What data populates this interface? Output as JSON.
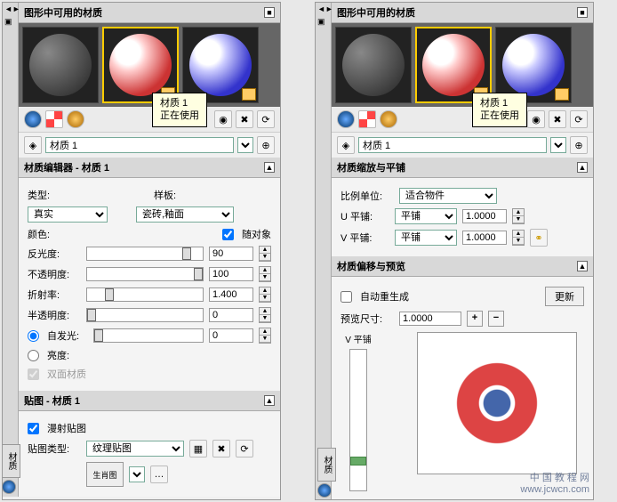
{
  "left": {
    "vtabs": [
      "材质"
    ],
    "header": "图形中可用的材质",
    "tooltip": {
      "line1": "材质 1",
      "line2": "正在使用"
    },
    "material_name": "材质 1",
    "editor_header": "材质编辑器 - 材质 1",
    "type_label": "类型:",
    "type_value": "真实",
    "template_label": "样板:",
    "template_value": "瓷砖,釉面",
    "color_label": "颜色:",
    "follow_obj": "随对象",
    "gloss_label": "反光度:",
    "gloss_value": "90",
    "opacity_label": "不透明度:",
    "opacity_value": "100",
    "refract_label": "折射率:",
    "refract_value": "1.400",
    "translucency_label": "半透明度:",
    "translucency_value": "0",
    "self_illum": "自发光:",
    "self_illum_value": "0",
    "brightness": "亮度:",
    "double_sided": "双面材质",
    "map_header": "贴图 - 材质 1",
    "diffuse_map": "漫射贴图",
    "map_type_label": "贴图类型:",
    "map_type_value": "纹理贴图",
    "thumb_label": "生肖图"
  },
  "right": {
    "header": "图形中可用的材质",
    "tooltip": {
      "line1": "材质 1",
      "line2": "正在使用"
    },
    "material_name": "材质 1",
    "scale_header": "材质缩放与平铺",
    "scale_unit_label": "比例单位:",
    "scale_unit_value": "适合物件",
    "u_tile_label": "U 平铺:",
    "u_tile_mode": "平铺",
    "u_tile_value": "1.0000",
    "v_tile_label": "V 平铺:",
    "v_tile_mode": "平铺",
    "v_tile_value": "1.0000",
    "offset_header": "材质偏移与预览",
    "auto_regen": "自动重生成",
    "update_btn": "更新",
    "preview_size_label": "预览尺寸:",
    "preview_size_value": "1.0000",
    "v_tile_preview": "V 平铺",
    "watermark1": "中 国 教 程 网",
    "watermark2": "www.jcwcn.com"
  }
}
